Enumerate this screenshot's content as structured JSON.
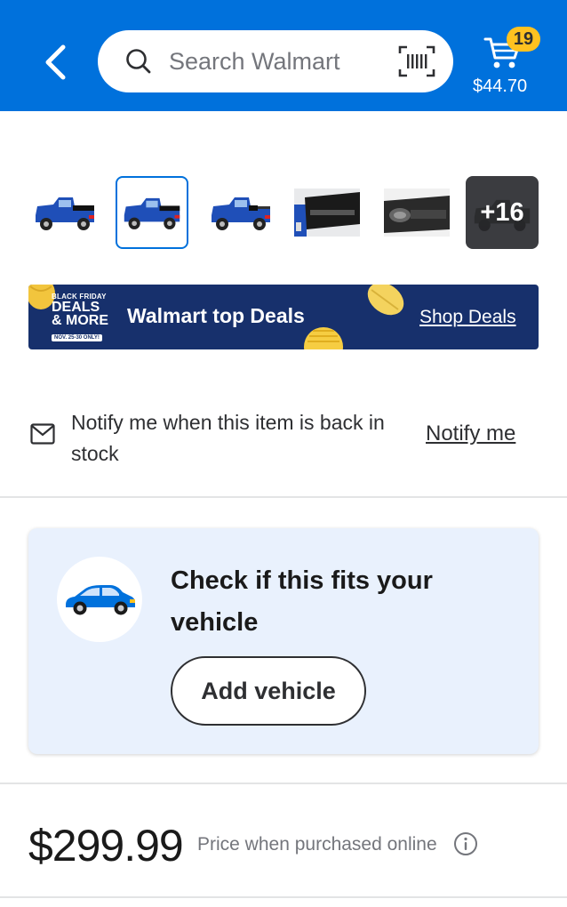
{
  "header": {
    "search_placeholder": "Search Walmart",
    "cart_count": "19",
    "cart_total": "$44.70",
    "icons": [
      "back-chevron-icon",
      "search-icon",
      "barcode-scanner-icon",
      "cart-icon"
    ],
    "colors": {
      "brand_blue": "#0071dc",
      "badge_yellow": "#ffc220"
    }
  },
  "gallery": {
    "thumbnails": [
      {
        "label": "Blue pickup truck with tonneau cover, rear three-quarter view"
      },
      {
        "label": "Blue pickup truck with tonneau cover, selected view"
      },
      {
        "label": "Blue pickup truck with rolled-up tonneau cover"
      },
      {
        "label": "Tonneau cover rail detail close-up"
      },
      {
        "label": "Rolled tonneau cover in truck bed"
      }
    ],
    "selected_index": 1,
    "more_label": "+16"
  },
  "banner": {
    "badge_line1": "BLACK FRIDAY",
    "badge_line2": "DEALS",
    "badge_line3": "& MORE",
    "badge_dates": "NOV. 25-30 ONLY!",
    "title": "Walmart top Deals",
    "link": "Shop Deals",
    "colors": {
      "background": "#17306c"
    }
  },
  "notify": {
    "text": "Notify me when this item is back in stock",
    "link": "Notify me",
    "icon": "mail-icon"
  },
  "vehicle": {
    "title": "Check if this fits your vehicle",
    "button": "Add vehicle",
    "icon": "car-icon",
    "colors": {
      "card_background": "#e9f1fd",
      "car_blue": "#0071dc"
    }
  },
  "price": {
    "amount": "$299.99",
    "note": "Price when purchased online",
    "icon": "info-icon"
  }
}
